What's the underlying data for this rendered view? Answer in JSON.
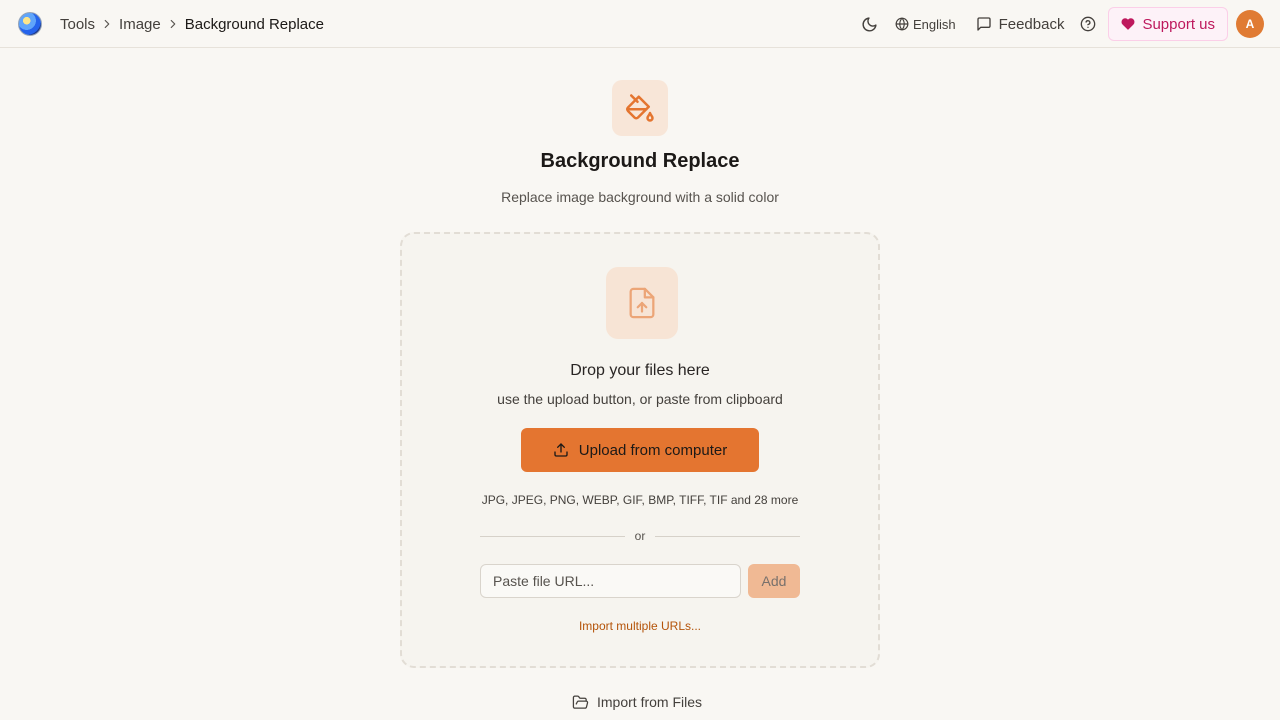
{
  "header": {
    "breadcrumbs": [
      "Tools",
      "Image",
      "Background Replace"
    ],
    "language": "English",
    "feedback": "Feedback",
    "support": "Support us",
    "avatar_initial": "A"
  },
  "main": {
    "title": "Background Replace",
    "subtitle": "Replace image background with a solid color",
    "dropzone": {
      "title": "Drop your files here",
      "subtitle": "use the upload button, or paste from clipboard",
      "upload_label": "Upload from computer",
      "formats": "JPG, JPEG, PNG, WEBP, GIF, BMP, TIFF, TIF and 28 more",
      "or": "or",
      "url_placeholder": "Paste file URL...",
      "add_label": "Add",
      "import_multiple": "Import multiple URLs..."
    },
    "import_files": "Import from Files"
  },
  "colors": {
    "accent": "#e47530",
    "support": "#be185d",
    "background": "#f9f7f3"
  },
  "icons": {
    "hero": "paint-bucket-icon",
    "dropzone": "file-upload-icon"
  }
}
